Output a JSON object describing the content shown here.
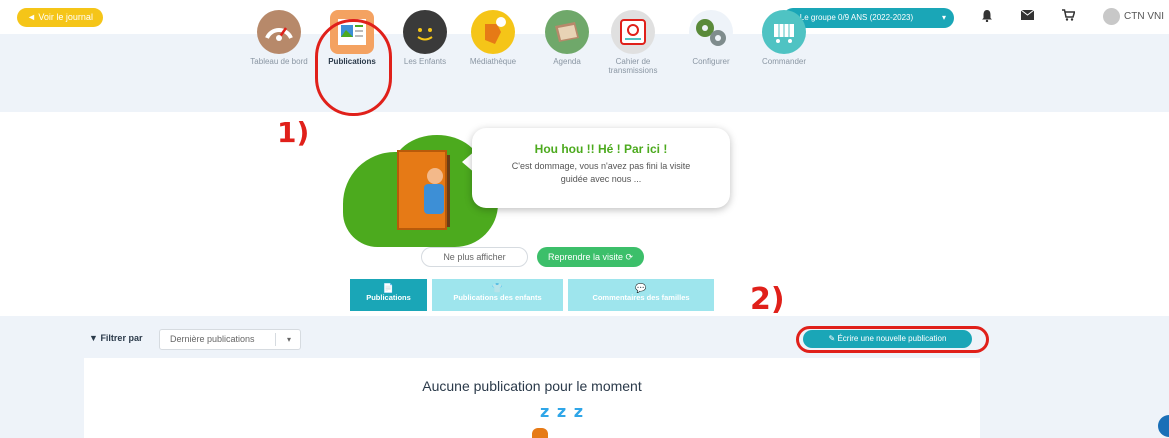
{
  "topbar": {
    "journal_button": "◄ Voir le journal",
    "group_selector": "Le groupe 0/9 ANS (2022-2023)",
    "user_name": "CTN VNI"
  },
  "nav": {
    "items": [
      {
        "label": "Tableau de bord",
        "icon": "dashboard-gauge-icon",
        "color": "#b7896a"
      },
      {
        "label": "Publications",
        "icon": "publications-icon",
        "color": "#f4a261"
      },
      {
        "label": "Les Enfants",
        "icon": "children-icon",
        "color": "#3a3a3a"
      },
      {
        "label": "Médiathèque",
        "icon": "media-library-icon",
        "color": "#f5c518"
      },
      {
        "label": "Agenda",
        "icon": "agenda-icon",
        "color": "#6fa86a"
      },
      {
        "label": "Cahier de transmissions",
        "icon": "notebook-icon",
        "color": "#e0e0e0"
      },
      {
        "label": "Configurer",
        "icon": "settings-gears-icon",
        "color": "#5a8a3a"
      },
      {
        "label": "Commander",
        "icon": "shopping-cart-icon",
        "color": "#4fc3c3"
      }
    ],
    "active_index": 1
  },
  "annotations": {
    "one": "1)",
    "two": "2)"
  },
  "tour": {
    "title": "Hou hou !! Hé ! Par ici !",
    "subtitle": "C'est dommage, vous n'avez pas fini la visite guidée avec nous ...",
    "dismiss_button": "Ne plus afficher",
    "resume_button": "Reprendre la visite ⟳"
  },
  "tabs": [
    {
      "label": "Publications",
      "icon": "📄",
      "active": true
    },
    {
      "label": "Publications des enfants",
      "icon": "👕",
      "active": false
    },
    {
      "label": "Commentaires des familles",
      "icon": "💬",
      "active": false
    }
  ],
  "filter": {
    "label": "Filtrer par",
    "selected": "Dernière publications"
  },
  "new_publication_button": "✎ Écrire une nouvelle publication",
  "empty_state": {
    "message": "Aucune publication pour le moment",
    "zzz": "z z z"
  }
}
